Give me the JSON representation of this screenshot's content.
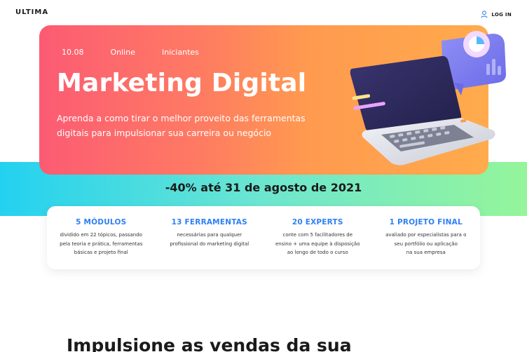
{
  "header": {
    "logo_text": "ULTIMA",
    "login_label": "LOG IN",
    "login_icon": "user-icon"
  },
  "hero": {
    "date": "10.08",
    "mode": "Online",
    "level": "Iniciantes",
    "title": "Marketing Digital",
    "description": "Aprenda a como tirar o melhor proveito das ferramentas digitais para impulsionar sua carreira ou negócio",
    "gradient_start": "#fc5b73",
    "gradient_end": "#ffab4c",
    "illustration": "laptop-illustration"
  },
  "promo": {
    "text": "-40% até 31 de agosto de 2021",
    "band_start": "#23d1f0",
    "band_end": "#95f59a"
  },
  "features": [
    {
      "title": "5 MÓDULOS",
      "desc": "dividido em 22 tópicos, passando\npela teoria e prática, ferramentas\nbásicas e projeto final"
    },
    {
      "title": "13 FERRAMENTAS",
      "desc": "necessárias para qualquer\nprofissional do marketing digital"
    },
    {
      "title": "20 EXPERTS",
      "desc": "conte com 5 facilitadores de\nensino + uma equipe à disposição\nao longo de todo o curso"
    },
    {
      "title": "1 PROJETO FINAL",
      "desc": "avaliado por especialistas para o\nseu portfólio ou aplicação\nna sua empresa"
    }
  ],
  "section": {
    "title": "Impulsione as vendas da sua"
  },
  "accent_color": "#2f80f2"
}
